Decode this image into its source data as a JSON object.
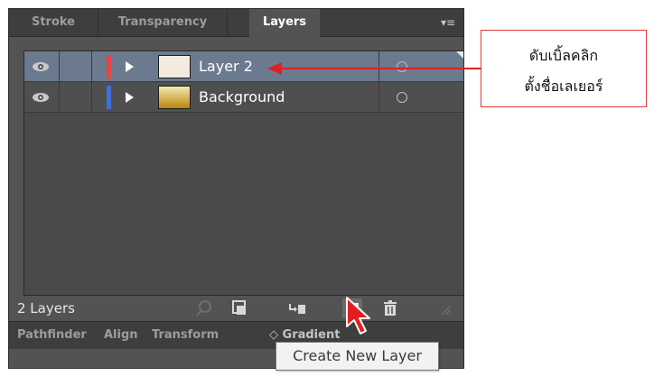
{
  "panel": {
    "tabs": [
      "Stroke",
      "Transparency",
      "Layers"
    ],
    "active_tab": "Layers",
    "menu_icon": "panel-menu-icon",
    "layers": [
      {
        "name": "Layer 2",
        "color": "#e84545",
        "thumbnail": [
          "#f4ebdf",
          "#f4ebdf"
        ],
        "selected": true
      },
      {
        "name": "Background",
        "color": "#3d6fe0",
        "thumbnail": [
          "#f5e9b0",
          "#b8860b"
        ],
        "selected": false
      }
    ],
    "layer_count": "2 Layers",
    "bottom_icons": [
      "locate-object-icon",
      "make-clipping-mask-icon",
      "create-sublayer-icon",
      "create-new-layer-icon",
      "delete-icon"
    ],
    "lower_tabs": [
      "Pathfinder",
      "Align",
      "Transform",
      "◇ Gradient"
    ]
  },
  "tooltip": "Create New Layer",
  "callout": {
    "line1": "ดับเบิ้ลคลิก",
    "line2": "ตั้งชื่อเลเยอร์",
    "border_color": "#e03a3a"
  },
  "colors": {
    "panel_bg": "#535353",
    "selection": "#6b7a8e",
    "arrow": "#e02020"
  }
}
